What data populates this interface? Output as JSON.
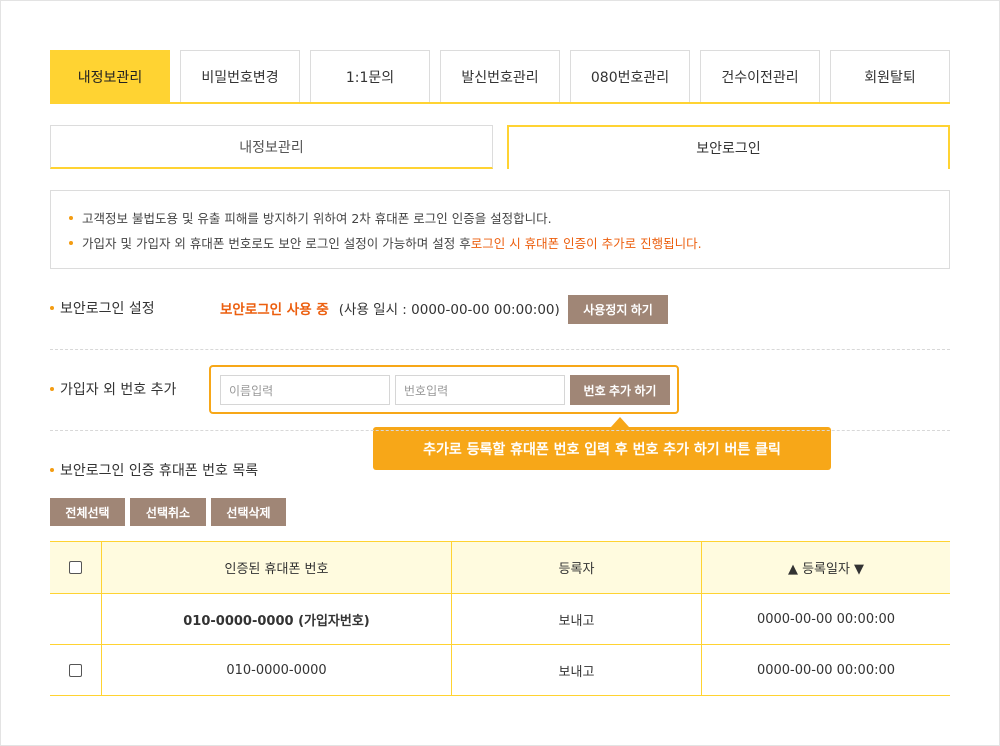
{
  "top_tabs": [
    {
      "label": "내정보관리",
      "active": true
    },
    {
      "label": "비밀번호변경",
      "active": false
    },
    {
      "label": "1:1문의",
      "active": false
    },
    {
      "label": "발신번호관리",
      "active": false
    },
    {
      "label": "080번호관리",
      "active": false
    },
    {
      "label": "건수이전관리",
      "active": false
    },
    {
      "label": "회원탈퇴",
      "active": false
    }
  ],
  "sub_tabs": [
    {
      "label": "내정보관리",
      "active": false
    },
    {
      "label": "보안로그인",
      "active": true
    }
  ],
  "notice": {
    "line1": "고객정보 불법도용 및 유출 피해를 방지하기 위하여 2차 휴대폰 로그인 인증을 설정합니다.",
    "line2_prefix": "가입자 및 가입자 외 휴대폰 번호로도 보안 로그인 설정이 가능하며 설정 후 ",
    "line2_highlight": "로그인 시 휴대폰 인증이 추가로 진행됩니다."
  },
  "secure_login": {
    "label": "보안로그인 설정",
    "status": "보안로그인 사용 중",
    "since": "(사용 일시 : 0000-00-00 00:00:00)",
    "stop_button": "사용정지 하기"
  },
  "add_number": {
    "label": "가입자 외 번호 추가",
    "name_placeholder": "이름입력",
    "number_placeholder": "번호입력",
    "add_button": "번호 추가 하기",
    "tooltip": "추가로 등록할 휴대폰 번호 입력 후 번호 추가 하기 버튼 클릭"
  },
  "list": {
    "label": "보안로그인 인증 휴대폰 번호 목록",
    "select_all": "전체선택",
    "deselect": "선택취소",
    "delete": "선택삭제",
    "columns": {
      "phone": "인증된 휴대폰 번호",
      "registrant": "등록자",
      "date": "▲ 등록일자 ▼"
    },
    "rows": [
      {
        "phone": "010-0000-0000 (가입자번호)",
        "registrant": "보내고",
        "date": "0000-00-00 00:00:00",
        "owner": true
      },
      {
        "phone": "010-0000-0000",
        "registrant": "보내고",
        "date": "0000-00-00 00:00:00",
        "owner": false
      }
    ]
  },
  "colors": {
    "accent_yellow": "#ffd332",
    "orange_text": "#ec5f0f",
    "tooltip_orange": "#f7a718",
    "button_brown": "#a08676"
  }
}
